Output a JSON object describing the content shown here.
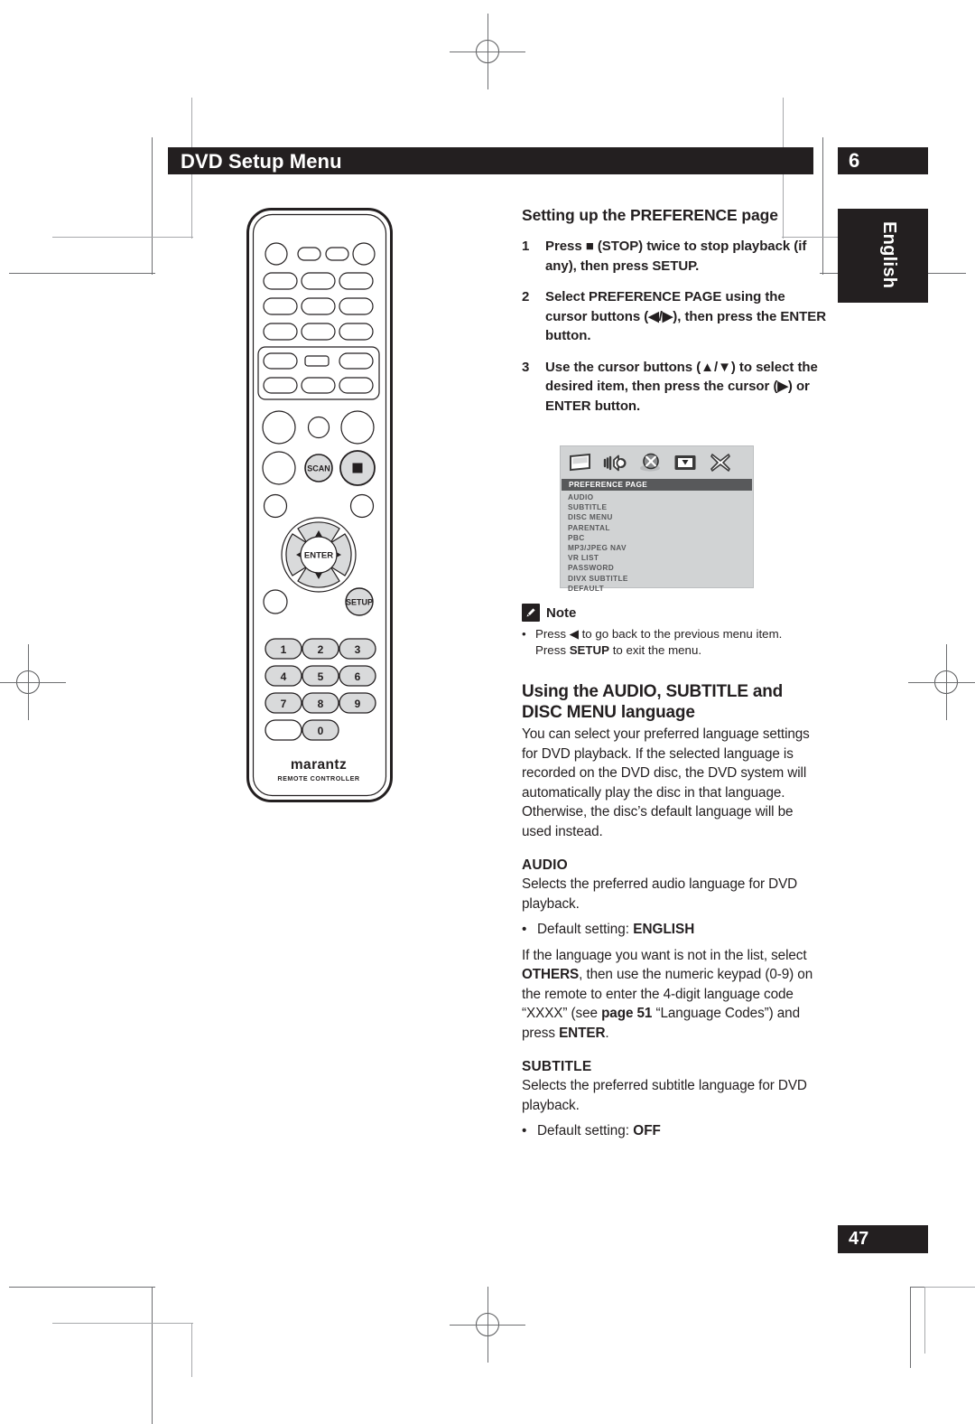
{
  "header": {
    "title": "DVD Setup Menu",
    "chapter": "6",
    "language_tab": "English"
  },
  "page_number": "47",
  "sections": {
    "preference": {
      "heading": "Setting up the PREFERENCE page",
      "steps": [
        {
          "num": "1",
          "text": "Press ■ (STOP) twice to stop playback (if any), then press SETUP."
        },
        {
          "num": "2",
          "text": "Select PREFERENCE PAGE using the cursor buttons (◀/▶), then press the ENTER button."
        },
        {
          "num": "3",
          "text": "Use the cursor buttons (▲/▼) to select the desired item, then press the cursor (▶) or ENTER button."
        }
      ]
    },
    "note": {
      "label": "Note",
      "icon": "pencil-icon",
      "bullet": "•",
      "line1": "Press ◀ to go back to the previous menu item.",
      "line2_prefix": "Press ",
      "line2_bold": "SETUP",
      "line2_suffix": " to exit the menu."
    },
    "language": {
      "heading": "Using the AUDIO, SUBTITLE and DISC MENU language",
      "body": "You can select your preferred language settings for DVD playback. If the selected language is recorded on the DVD disc, the DVD system will automatically play the disc in that language. Otherwise, the disc’s default language will be used instead."
    },
    "audio": {
      "heading": "AUDIO",
      "body": "Selects the preferred audio language for DVD playback.",
      "bullet_dot": "•",
      "bullet_label": "Default setting: ",
      "bullet_value": "ENGLISH",
      "note_a": "If the language you want is not in the list, select ",
      "note_b": "OTHERS",
      "note_c": ", then use the numeric keypad (0-9) on the remote to enter the 4-digit language code “XXXX” (see ",
      "note_d": "page 51",
      "note_e": " “Language Codes”) and press ",
      "note_f": "ENTER",
      "note_g": "."
    },
    "subtitle": {
      "heading": "SUBTITLE",
      "body": "Selects the preferred subtitle language for DVD playback.",
      "bullet_dot": "•",
      "bullet_label": "Default setting: ",
      "bullet_value": "OFF"
    }
  },
  "osd": {
    "icons": [
      "display-icon",
      "audio-speaker-icon",
      "disc-icon",
      "video-icon",
      "close-x-icon"
    ],
    "title": "PREFERENCE PAGE",
    "items": [
      "AUDIO",
      "SUBTITLE",
      "DISC MENU",
      "PARENTAL",
      "PBC",
      "MP3/JPEG NAV",
      "VR LIST",
      "PASSWORD",
      "DIVX SUBTITLE",
      "DEFAULT"
    ]
  },
  "remote": {
    "brand": "marantz",
    "subtitle": "REMOTE CONTROLLER",
    "labels": {
      "enter": "ENTER",
      "setup": "SETUP",
      "scan": "SCAN"
    },
    "keypad": [
      "1",
      "2",
      "3",
      "4",
      "5",
      "6",
      "7",
      "8",
      "9",
      "0"
    ]
  },
  "colors": {
    "ink": "#231f20",
    "osd_bg": "#d1d3d4",
    "osd_highlight": "#58595b",
    "crop_mark": "#6d6e71"
  }
}
